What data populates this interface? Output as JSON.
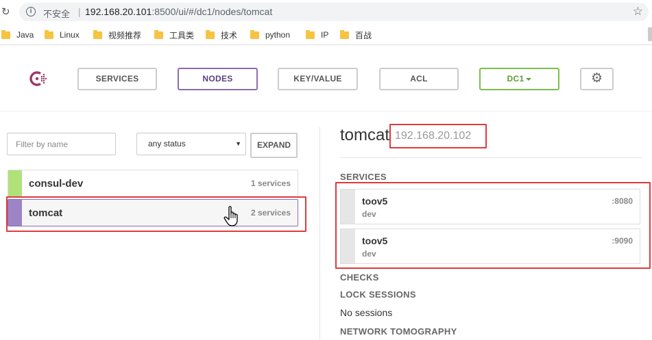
{
  "browser": {
    "security_label": "不安全",
    "separator": "|",
    "url_host": "192.168.20.101",
    "url_rest": ":8500/ui/#/dc1/nodes/tomcat",
    "bookmarks": [
      "Java",
      "Linux",
      "视频推荐",
      "工具类",
      "技术",
      "python",
      "IP",
      "百战"
    ]
  },
  "nav": {
    "services": "SERVICES",
    "nodes": "NODES",
    "key_value": "KEY/VALUE",
    "acl": "ACL",
    "datacenter": "DC1",
    "active": "NODES"
  },
  "filters": {
    "name_placeholder": "Filter by name",
    "name_value": "",
    "status_value": "any status",
    "expand_label": "EXPAND"
  },
  "nodes": [
    {
      "name": "consul-dev",
      "services": "1 services",
      "status_color": "#b0e27a",
      "selected": false
    },
    {
      "name": "tomcat",
      "services": "2 services",
      "status_color": "#9d84c6",
      "selected": true
    }
  ],
  "detail": {
    "node_name": "tomcat",
    "node_address": "192.168.20.102",
    "services_heading": "SERVICES",
    "services": [
      {
        "name": "toov5",
        "tag": "dev",
        "port": ":8080"
      },
      {
        "name": "toov5",
        "tag": "dev",
        "port": ":9090"
      }
    ],
    "checks_heading": "CHECKS",
    "lock_sessions_heading": "LOCK SESSIONS",
    "no_sessions": "No sessions",
    "tomography_heading": "NETWORK TOMOGRAPHY"
  },
  "colors": {
    "brand_purple": "#8c6bb1",
    "dc_green": "#7bbf4a",
    "highlight_red": "#e0393e"
  }
}
